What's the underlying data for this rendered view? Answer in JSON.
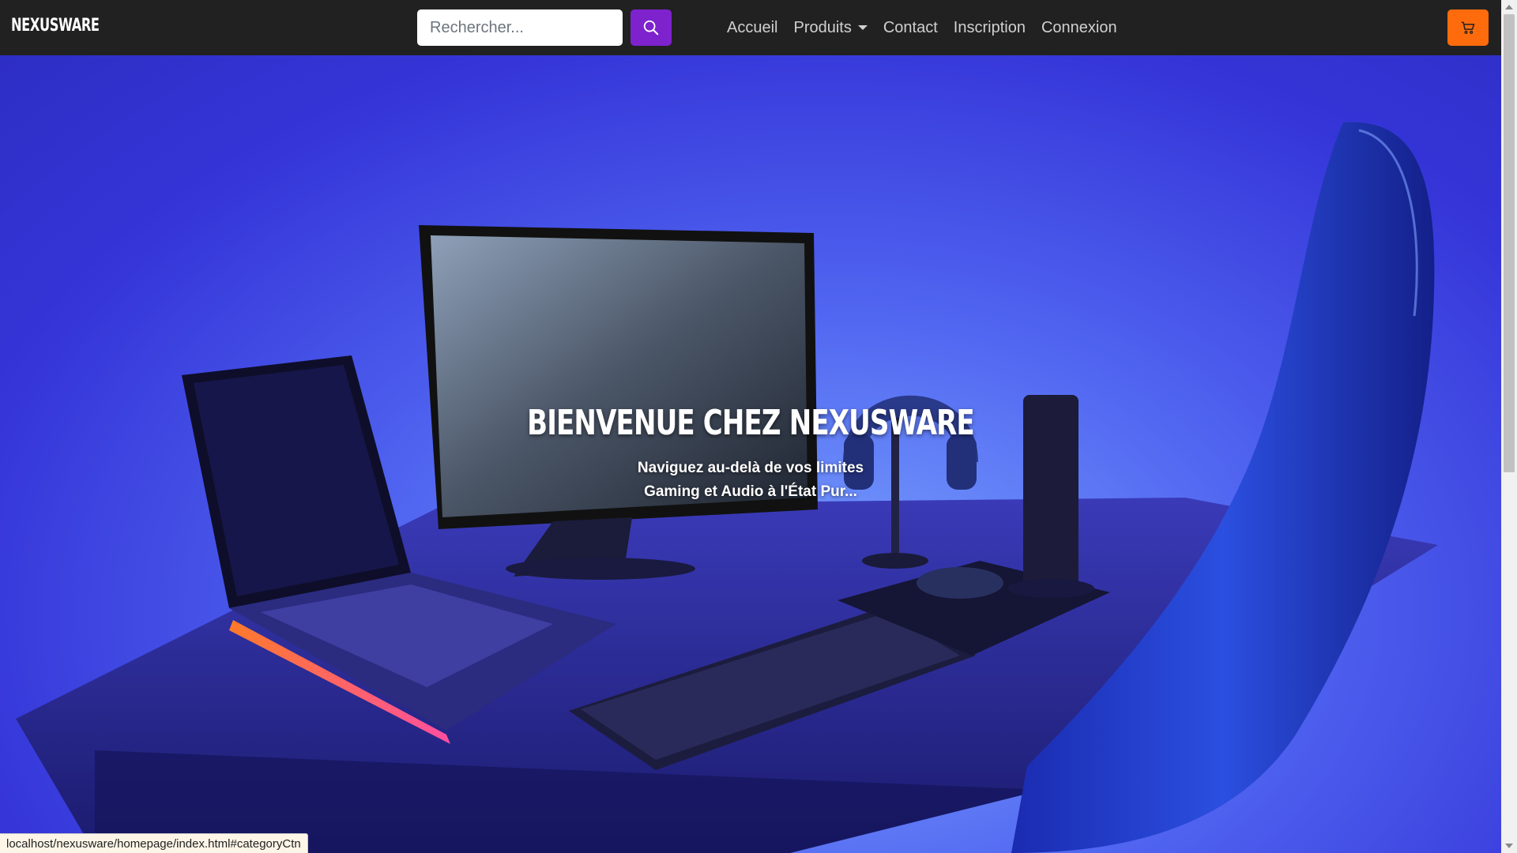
{
  "brand": "NEXUSWARE",
  "search": {
    "placeholder": "Rechercher..."
  },
  "nav": {
    "items": [
      {
        "label": "Accueil"
      },
      {
        "label": "Produits"
      },
      {
        "label": "Contact"
      },
      {
        "label": "Inscription"
      },
      {
        "label": "Connexion"
      }
    ]
  },
  "hero": {
    "title": "BIENVENUE CHEZ NEXUSWARE",
    "line1": "Naviguez au-delà de vos limites",
    "line2": "Gaming et Audio à l'État Pur..."
  },
  "status_url": "localhost/nexusware/homepage/index.html#categoryCtn",
  "icons": {
    "search": "search-icon",
    "cart": "cart-icon"
  },
  "colors": {
    "navbar": "#212121",
    "search_button": "#7e22ce",
    "cart_button": "#fd6b0d",
    "hero_blue": "#3535d8"
  }
}
